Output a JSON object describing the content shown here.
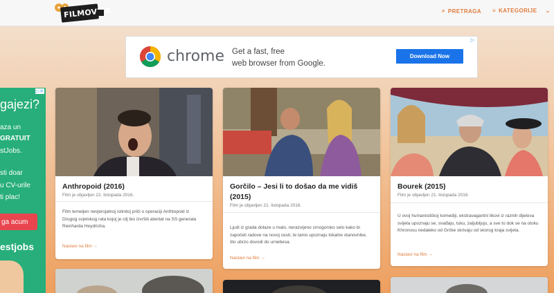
{
  "header": {
    "logo_text": "FILMOVITA",
    "search_label": "PRETRAGA",
    "categories_label": "KATEGORIJE"
  },
  "ad_banner": {
    "brand": "chrome",
    "line1": "Get a fast, free",
    "line2": "web browser from Google.",
    "button_label": "Download Now"
  },
  "side_ad": {
    "line1": "gajezi?",
    "line2": "aza un",
    "line3": "GRATUIT",
    "line4": "stJobs.",
    "line5": "sti doar",
    "line6": "u CV-urile",
    "line7": "ti plac!",
    "button_label": "ga acum",
    "brand": "estjobs"
  },
  "posts": [
    {
      "title": "Anthropoid (2016)",
      "meta": "Film je objavljen 22. listopada 2016.",
      "excerpt": "Film temeljen nevjerojatnoj istinitoj priči o operaciji Anthtopoid iz Drugog svjetskog rata kojoj je cilj bio izvršiti atentat na SS generala Reinharda Heydricha.",
      "read_more": "Nastavi na film →"
    },
    {
      "title": "Gorčilo – Jesi li to došao da me vidiš (2015)",
      "meta": "Film je objavljen 21. listopada 2016.",
      "excerpt": "Ljudi iz grada dolaze u malo, nerazvijeno crnogorsko selo kako bi započeli radove na novoj cesti, te tamo upoznaju lokalne stanovnike, što ubrzo dovodi do urnebesa.",
      "read_more": "Nastavi na film →"
    },
    {
      "title": "Bourek (2015)",
      "meta": "Film je objavljen 21. listopada 2016.",
      "excerpt": "U ovoj humanističkoj komediji, ekstravagantni likovi iz raznih dijelova svijeta upoznaju se, svađaju, tuku, zaljubljuju, a sve to dok se na otoku Khronosu nedaleko od Grčke skrivaju od skorog kraja svijeta.",
      "read_more": "Nastavi na film →"
    }
  ],
  "colors": {
    "accent": "#e07b3b",
    "ad_green": "#27ae7a",
    "ad_button": "#1a73e8"
  }
}
